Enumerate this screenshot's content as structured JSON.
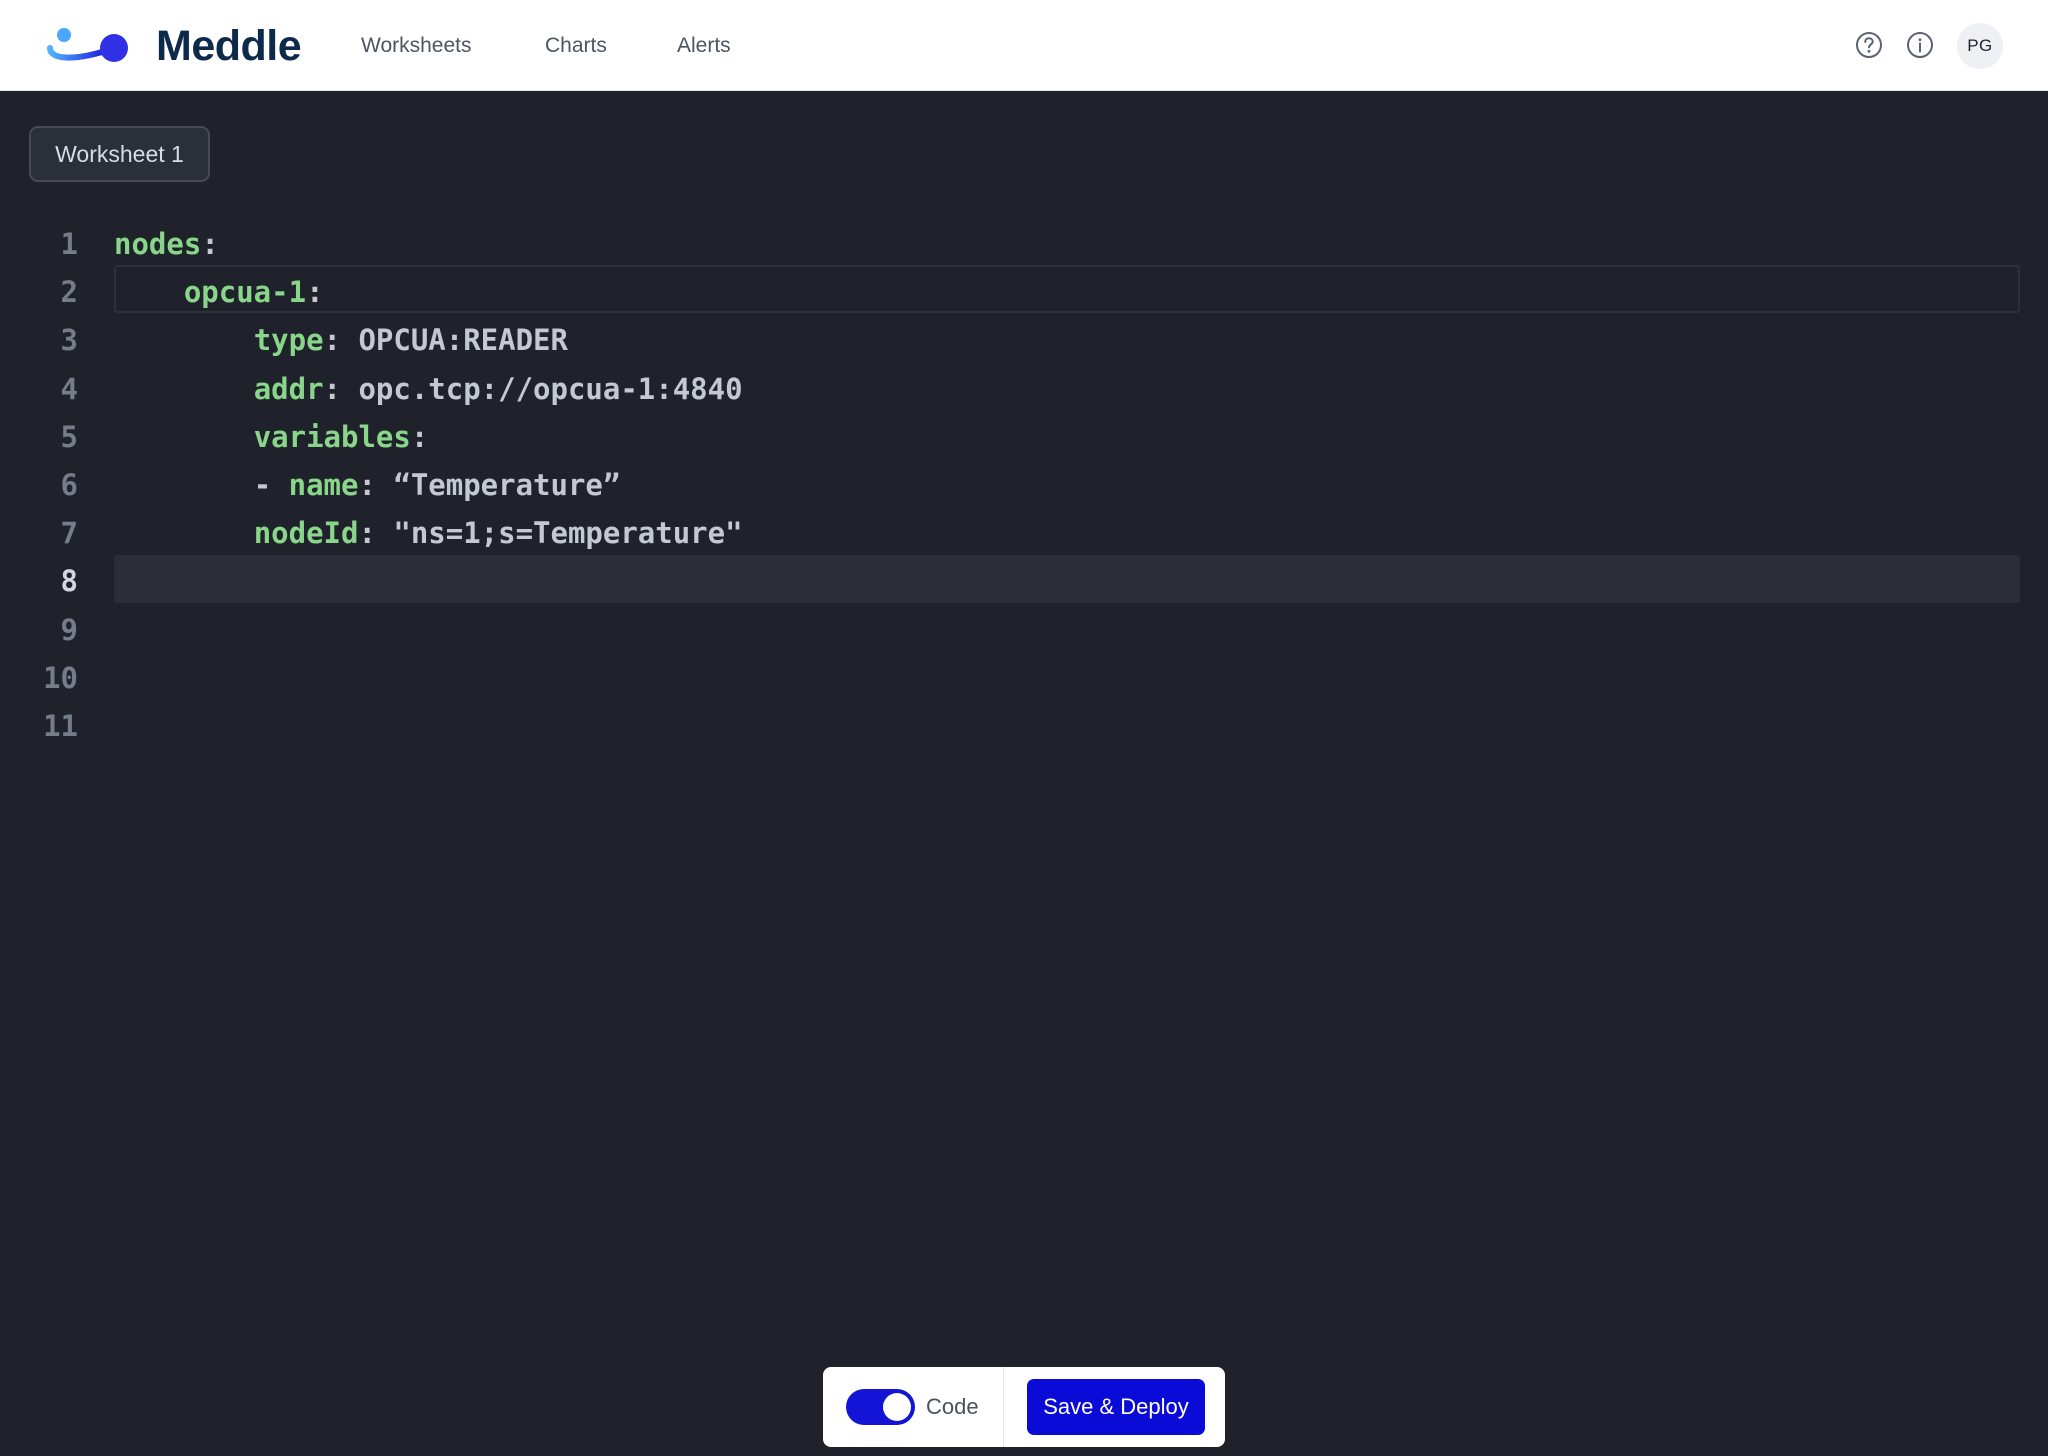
{
  "app": {
    "brand": "Meddle"
  },
  "nav": {
    "items": [
      {
        "label": "Worksheets"
      },
      {
        "label": "Charts"
      },
      {
        "label": "Alerts"
      }
    ]
  },
  "header": {
    "help_icon": "help-circle-icon",
    "info_icon": "info-circle-icon",
    "avatar_initials": "PG"
  },
  "worksheet": {
    "tab_label": "Worksheet 1"
  },
  "editor": {
    "active_line": 8,
    "lines": [
      {
        "num": "1",
        "indent": "",
        "prefix": "",
        "key": "nodes",
        "sep": ":",
        "value": ""
      },
      {
        "num": "2",
        "indent": "    ",
        "prefix": "",
        "key": "opcua-1",
        "sep": ":",
        "value": ""
      },
      {
        "num": "3",
        "indent": "        ",
        "prefix": "",
        "key": "type",
        "sep": ": ",
        "value": "OPCUA:READER"
      },
      {
        "num": "4",
        "indent": "        ",
        "prefix": "",
        "key": "addr",
        "sep": ": ",
        "value": "opc.tcp://opcua-1:4840"
      },
      {
        "num": "5",
        "indent": "        ",
        "prefix": "",
        "key": "variables",
        "sep": ":",
        "value": ""
      },
      {
        "num": "6",
        "indent": "        ",
        "prefix": "- ",
        "key": "name",
        "sep": ": ",
        "value": "“Temperature”"
      },
      {
        "num": "7",
        "indent": "        ",
        "prefix": "",
        "key": "nodeId",
        "sep": ": ",
        "value": "\"ns=1;s=Temperature\""
      },
      {
        "num": "8",
        "indent": "",
        "prefix": "",
        "key": "",
        "sep": "",
        "value": ""
      },
      {
        "num": "9",
        "indent": "",
        "prefix": "",
        "key": "",
        "sep": "",
        "value": ""
      },
      {
        "num": "10",
        "indent": "",
        "prefix": "",
        "key": "",
        "sep": "",
        "value": ""
      },
      {
        "num": "11",
        "indent": "",
        "prefix": "",
        "key": "",
        "sep": "",
        "value": ""
      }
    ]
  },
  "actions": {
    "code_toggle_label": "Code",
    "code_toggle_on": true,
    "save_label": "Save & Deploy"
  },
  "colors": {
    "brand_blue": "#0b0bd8",
    "editor_bg": "#1f222b",
    "yaml_key": "#89d68a"
  }
}
